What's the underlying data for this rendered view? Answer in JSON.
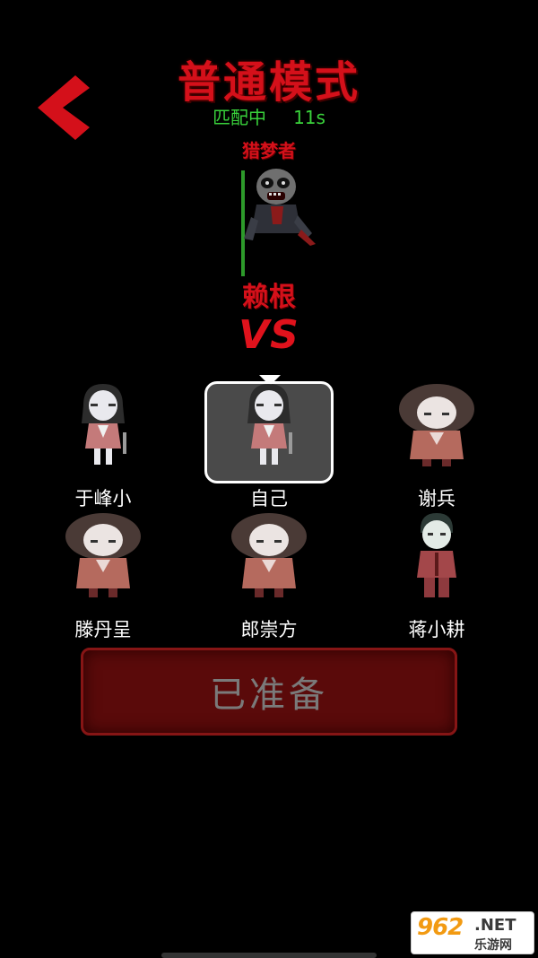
{
  "header": {
    "title": "普通模式",
    "back_icon": "chevron-left-icon",
    "accent_color": "#d4101a"
  },
  "match": {
    "status_label": "匹配中",
    "timer": "11s",
    "status_color": "#39d23b"
  },
  "hunter": {
    "role_label": "猎梦者",
    "name": "赖根"
  },
  "versus": {
    "label": "VS"
  },
  "players": [
    {
      "name": "于峰小",
      "avatar": "girl-character",
      "is_self": false
    },
    {
      "name": "自己",
      "avatar": "girl-character",
      "is_self": true
    },
    {
      "name": "谢兵",
      "avatar": "bob-hair-character",
      "is_self": false
    },
    {
      "name": "滕丹呈",
      "avatar": "bob-hair-character",
      "is_self": false
    },
    {
      "name": "郎崇方",
      "avatar": "bob-hair-character",
      "is_self": false
    },
    {
      "name": "蒋小耕",
      "avatar": "boy-character",
      "is_self": false
    }
  ],
  "ready_button": {
    "label": "已准备"
  },
  "watermark": {
    "logo": "962",
    "suffix": ".NET",
    "site": "乐游网"
  }
}
